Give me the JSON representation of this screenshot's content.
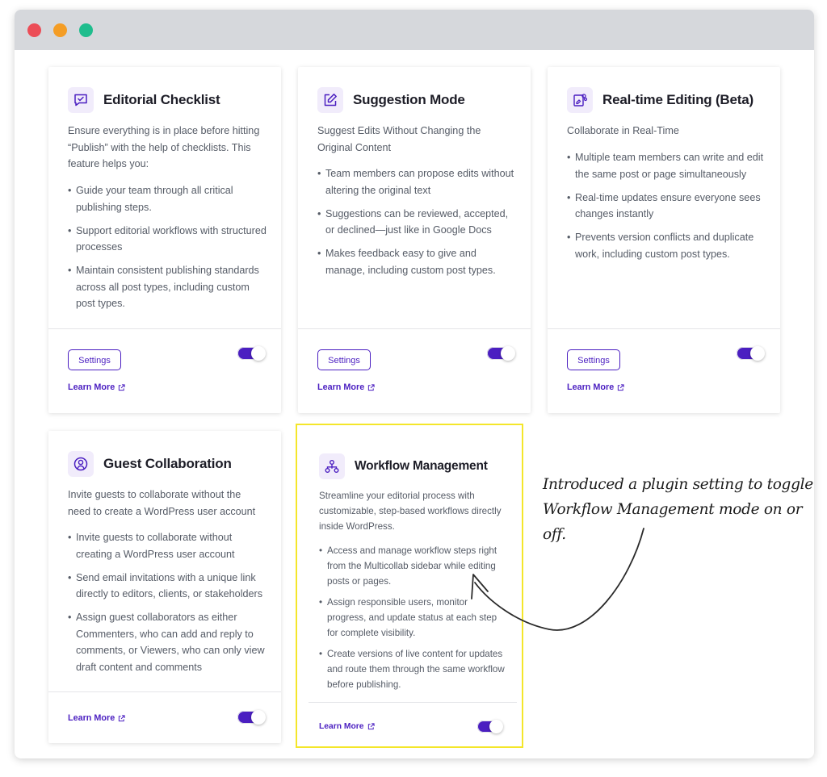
{
  "window": {
    "controls": [
      "close",
      "minimize",
      "maximize"
    ]
  },
  "cards": {
    "editorial": {
      "icon": "checklist-icon",
      "title": "Editorial Checklist",
      "description": "Ensure everything is in place before hitting “Publish” with the help of checklists. This feature helps you:",
      "bullets": [
        "Guide your team through all critical publishing steps.",
        "Support editorial workflows with structured processes",
        "Maintain consistent publishing standards across all post types, including custom post types."
      ],
      "settings_label": "Settings",
      "learn_more": "Learn More",
      "enabled": true
    },
    "suggestion": {
      "icon": "edit-icon",
      "title": "Suggestion Mode",
      "description": "Suggest Edits Without Changing the Original Content",
      "bullets": [
        "Team members can propose edits without altering the original text",
        "Suggestions can be reviewed, accepted, or declined—just like in Google Docs",
        "Makes feedback easy to give and manage, including custom post types."
      ],
      "settings_label": "Settings",
      "learn_more": "Learn More",
      "enabled": true
    },
    "realtime": {
      "icon": "realtime-edit-icon",
      "title": "Real-time Editing (Beta)",
      "description": "Collaborate in Real-Time",
      "bullets": [
        "Multiple team members can write and edit the same post or page simultaneously",
        "Real-time updates ensure everyone sees changes instantly",
        "Prevents version conflicts and duplicate work, including custom post types."
      ],
      "settings_label": "Settings",
      "learn_more": "Learn More",
      "enabled": true
    },
    "guest": {
      "icon": "user-circle-icon",
      "title": "Guest Collaboration",
      "description": "Invite guests to collaborate without the need to create a WordPress user account",
      "bullets": [
        "Invite guests to collaborate without creating a WordPress user account",
        "Send email invitations with a unique link directly to editors, clients, or stakeholders",
        "Assign guest collaborators as either Commenters, who can add and reply to comments, or Viewers, who can only view draft content and comments"
      ],
      "learn_more": "Learn More",
      "enabled": true
    },
    "workflow": {
      "icon": "workflow-icon",
      "title": "Workflow Management",
      "description": "Streamline your editorial process with customizable, step-based workflows directly inside WordPress.",
      "bullets": [
        "Access and manage workflow steps right from the Multicollab sidebar while editing posts or pages.",
        "Assign responsible users, monitor progress, and update status at each step for complete visibility.",
        "Create versions of live content for updates and route them through the same workflow before publishing."
      ],
      "learn_more": "Learn More",
      "enabled": true
    }
  },
  "annotation": {
    "line1": "Introduced a plugin setting to toggle",
    "line2": "Workflow Management mode on or off."
  },
  "colors": {
    "accent": "#4b1fc1",
    "icon_bg": "#f1ecfb",
    "highlight": "#f4e62a",
    "titlebar": "#d6d8dc"
  }
}
